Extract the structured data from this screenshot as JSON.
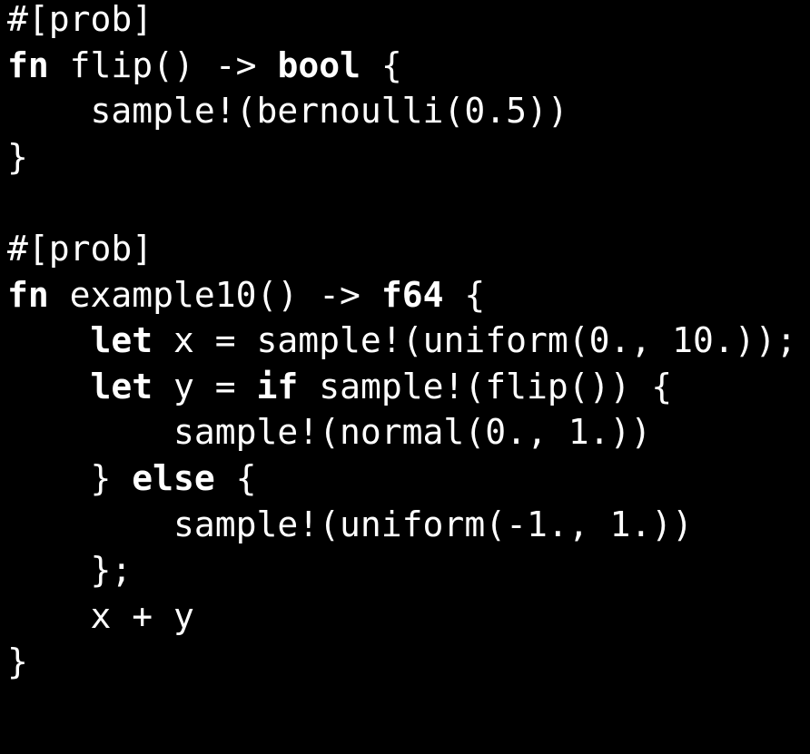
{
  "editor": {
    "background": "#000000",
    "text_color": "#ffffff",
    "lines": [
      [
        {
          "t": "#[prob]",
          "kw": false
        }
      ],
      [
        {
          "t": "fn",
          "kw": true
        },
        {
          "t": " flip() -> ",
          "kw": false
        },
        {
          "t": "bool",
          "kw": true
        },
        {
          "t": " {",
          "kw": false
        }
      ],
      [
        {
          "t": "    sample!(bernoulli(0.5))",
          "kw": false
        }
      ],
      [
        {
          "t": "}",
          "kw": false
        }
      ],
      [
        {
          "t": "",
          "kw": false
        }
      ],
      [
        {
          "t": "#[prob]",
          "kw": false
        }
      ],
      [
        {
          "t": "fn",
          "kw": true
        },
        {
          "t": " example10() -> ",
          "kw": false
        },
        {
          "t": "f64",
          "kw": true
        },
        {
          "t": " {",
          "kw": false
        }
      ],
      [
        {
          "t": "    ",
          "kw": false
        },
        {
          "t": "let",
          "kw": true
        },
        {
          "t": " x = sample!(uniform(0., 10.));",
          "kw": false
        }
      ],
      [
        {
          "t": "    ",
          "kw": false
        },
        {
          "t": "let",
          "kw": true
        },
        {
          "t": " y = ",
          "kw": false
        },
        {
          "t": "if",
          "kw": true
        },
        {
          "t": " sample!(flip()) {",
          "kw": false
        }
      ],
      [
        {
          "t": "        sample!(normal(0., 1.))",
          "kw": false
        }
      ],
      [
        {
          "t": "    } ",
          "kw": false
        },
        {
          "t": "else",
          "kw": true
        },
        {
          "t": " {",
          "kw": false
        }
      ],
      [
        {
          "t": "        sample!(uniform(-1., 1.))",
          "kw": false
        }
      ],
      [
        {
          "t": "    };",
          "kw": false
        }
      ],
      [
        {
          "t": "    x + y",
          "kw": false
        }
      ],
      [
        {
          "t": "}",
          "kw": false
        }
      ]
    ]
  }
}
